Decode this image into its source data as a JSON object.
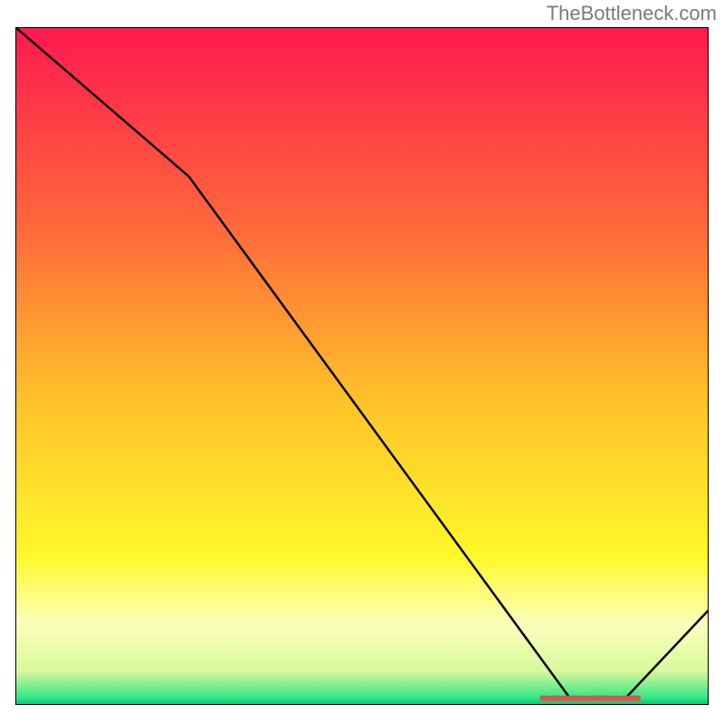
{
  "watermark": "TheBottleneck.com",
  "chart_data": {
    "type": "line",
    "title": "",
    "xlabel": "",
    "ylabel": "",
    "x_range": [
      0,
      100
    ],
    "y_range": [
      0,
      100
    ],
    "series": [
      {
        "name": "curve",
        "color": "#000000",
        "points": [
          {
            "x": 0,
            "y": 100
          },
          {
            "x": 25,
            "y": 78
          },
          {
            "x": 80,
            "y": 1
          },
          {
            "x": 88,
            "y": 1
          },
          {
            "x": 100,
            "y": 14
          }
        ]
      }
    ],
    "optimal_marker": {
      "x_start": 76,
      "x_end": 90,
      "y": 1,
      "color": "#d6564e"
    },
    "background_gradient": {
      "stops": [
        {
          "offset": 0,
          "color": "#ff1950"
        },
        {
          "offset": 30,
          "color": "#ff6a3a"
        },
        {
          "offset": 55,
          "color": "#ffc229"
        },
        {
          "offset": 78,
          "color": "#fff82a"
        },
        {
          "offset": 88,
          "color": "#fdffbc"
        },
        {
          "offset": 95,
          "color": "#d7f99c"
        },
        {
          "offset": 99,
          "color": "#2fe687"
        },
        {
          "offset": 100,
          "color": "#00c271"
        }
      ]
    },
    "axes_visible": false,
    "grid": false
  }
}
